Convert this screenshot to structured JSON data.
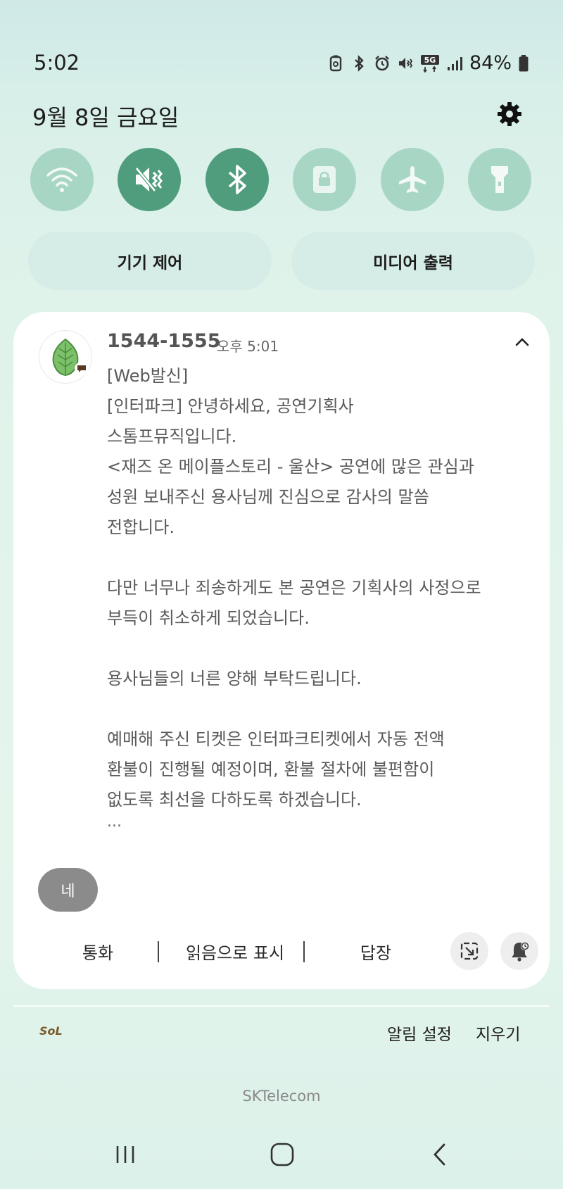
{
  "status_bar": {
    "time": "5:02",
    "battery_percent": "84%",
    "icons": [
      "battery-saver-icon",
      "bluetooth-icon",
      "alarm-icon",
      "vibrate-icon",
      "5g-icon",
      "signal-icon",
      "battery-icon"
    ],
    "network_label": "5G"
  },
  "header": {
    "date": "9월 8일 금요일",
    "settings_icon": "gear-icon"
  },
  "quick_toggles": [
    {
      "name": "wifi",
      "icon": "wifi-icon",
      "active": false
    },
    {
      "name": "sound",
      "icon": "mute-icon",
      "active": true
    },
    {
      "name": "bluetooth",
      "icon": "bluetooth-icon",
      "active": true
    },
    {
      "name": "rotation-lock",
      "icon": "lock-icon",
      "active": false
    },
    {
      "name": "airplane",
      "icon": "airplane-icon",
      "active": false
    },
    {
      "name": "flashlight",
      "icon": "flashlight-icon",
      "active": false
    }
  ],
  "pills": {
    "device_control": "기기 제어",
    "media_output": "미디어 출력"
  },
  "notification": {
    "sender": "1544-1555",
    "time": "오후 5:01",
    "lines": [
      "[Web발신]",
      "[인터파크] 안녕하세요, 공연기획사",
      "스톰프뮤직입니다.",
      "<재즈 온 메이플스토리 - 울산> 공연에 많은 관심과",
      "성원 보내주신 용사님께 진심으로 감사의 말씀",
      "전합니다.",
      "",
      "다만 너무나 죄송하게도 본 공연은 기획사의 사정으로",
      "부득이 취소하게 되었습니다.",
      "",
      "용사님들의 너른 양해 부탁드립니다.",
      "",
      "예매해 주신 티켓은 인터파크티켓에서 자동 전액",
      "환불이 진행될 예정이며, 환불 절차에 불편함이",
      "없도록 최선을 다하도록 하겠습니다."
    ],
    "ellipsis": "...",
    "quick_reply": "네",
    "actions": {
      "call": "통화",
      "mark_read": "읽음으로 표시",
      "reply": "답장"
    }
  },
  "footer": {
    "logo_text": "SoL",
    "notification_settings": "알림 설정",
    "clear": "지우기",
    "carrier": "SKTelecom"
  },
  "colors": {
    "toggle_on": "#4f9d7c",
    "toggle_off": "#a8d6c4",
    "pill_bg": "#d6ece6",
    "card_bg": "#ffffff",
    "quick_reply_bg": "#8b8b8b"
  }
}
